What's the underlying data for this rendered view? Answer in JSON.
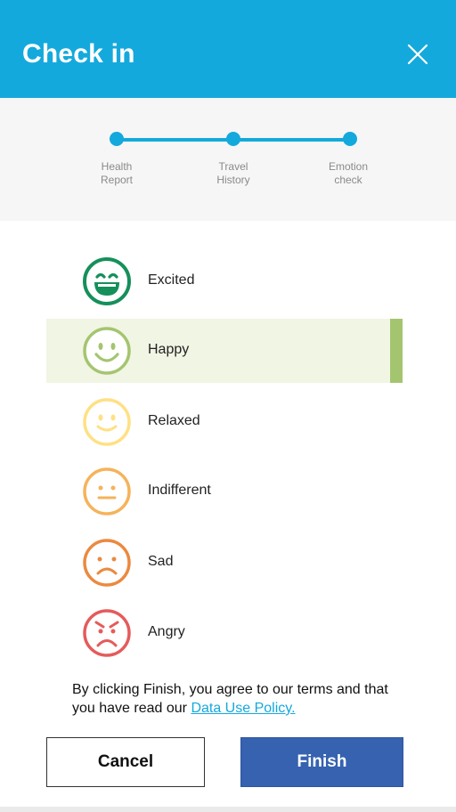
{
  "header": {
    "title": "Check in",
    "close_icon": "close-icon"
  },
  "stepper": {
    "steps": [
      {
        "label": "Health\nReport"
      },
      {
        "label": "Travel\nHistory"
      },
      {
        "label": "Emotion\ncheck"
      }
    ],
    "color": "#14a9dc"
  },
  "emotions": [
    {
      "label": "Excited",
      "icon": "excited-face-icon",
      "color": "#15905a",
      "selected": false
    },
    {
      "label": "Happy",
      "icon": "happy-face-icon",
      "color": "#a4c56f",
      "selected": true
    },
    {
      "label": "Relaxed",
      "icon": "relaxed-face-icon",
      "color": "#ffe083",
      "selected": false
    },
    {
      "label": "Indifferent",
      "icon": "indifferent-face-icon",
      "color": "#f5b35a",
      "selected": false
    },
    {
      "label": "Sad",
      "icon": "sad-face-icon",
      "color": "#ea8a40",
      "selected": false
    },
    {
      "label": "Angry",
      "icon": "angry-face-icon",
      "color": "#e55b5b",
      "selected": false
    }
  ],
  "consent": {
    "text": "By clicking Finish, you agree to our terms and that you have read our",
    "link": "Data Use Policy."
  },
  "buttons": {
    "cancel": "Cancel",
    "finish": "Finish"
  },
  "colors": {
    "header": "#14a9dc",
    "finish": "#3662b0",
    "selected_bg": "#f1f5e4",
    "selected_bar": "#a4c56f"
  }
}
